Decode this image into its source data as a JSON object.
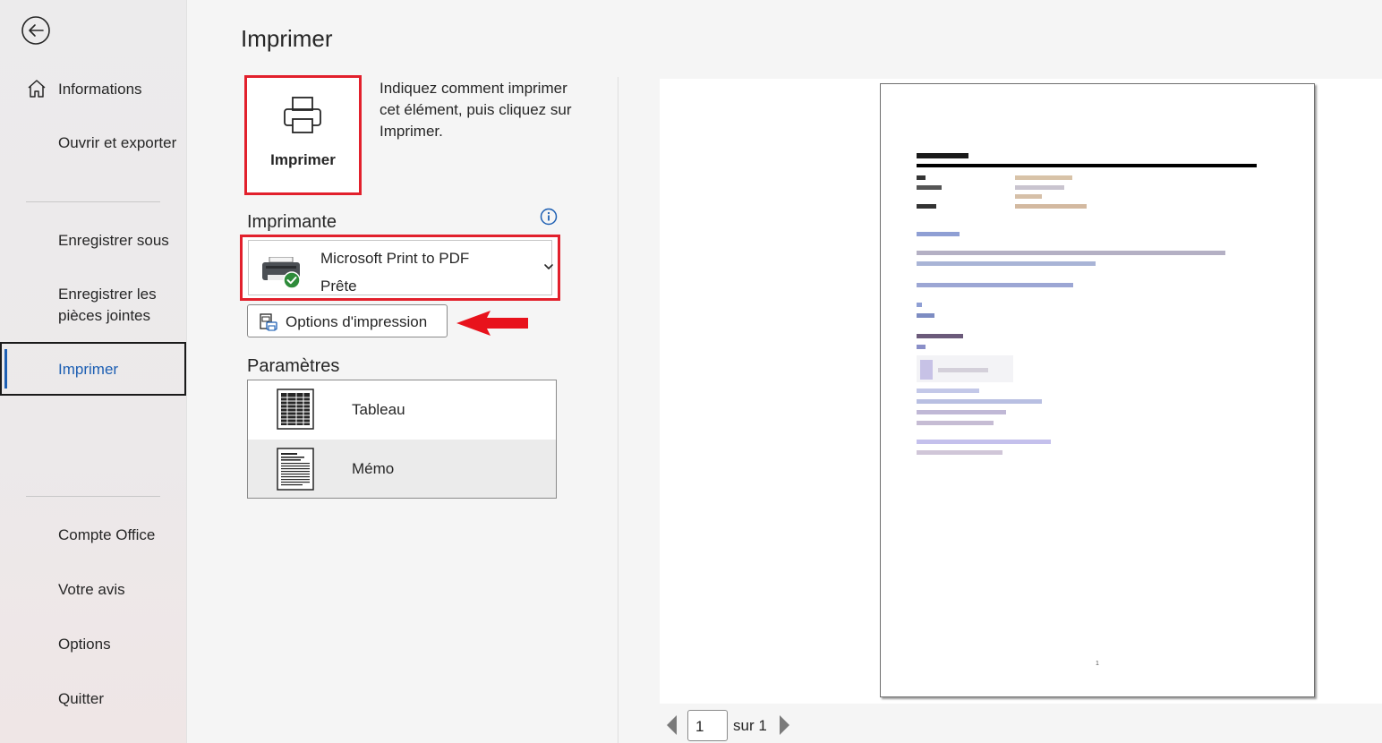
{
  "sidebar": {
    "items": [
      {
        "label": "Informations"
      },
      {
        "label": "Ouvrir et exporter"
      },
      {
        "label": "Enregistrer sous"
      },
      {
        "label": "Enregistrer les pièces jointes"
      },
      {
        "label": "Imprimer"
      },
      {
        "label": "Compte Office"
      },
      {
        "label": "Votre avis"
      },
      {
        "label": "Options"
      },
      {
        "label": "Quitter"
      }
    ],
    "active_index": 4,
    "accent_color": "#1d5fb3"
  },
  "print": {
    "title": "Imprimer",
    "print_button_label": "Imprimer",
    "description": "Indiquez comment imprimer cet élément, puis cliquez sur Imprimer.",
    "printer_heading": "Imprimante",
    "printer_name": "Microsoft Print to PDF",
    "printer_status": "Prête",
    "options_button_label": "Options d'impression",
    "settings_heading": "Paramètres",
    "styles": [
      {
        "label": "Tableau",
        "icon": "table-style-icon",
        "selected": false
      },
      {
        "label": "Mémo",
        "icon": "memo-style-icon",
        "selected": true
      }
    ],
    "highlight_color": "#e2202c"
  },
  "preview": {
    "page_number": "1",
    "page_of": "sur 1",
    "footer_page_number": "1"
  }
}
